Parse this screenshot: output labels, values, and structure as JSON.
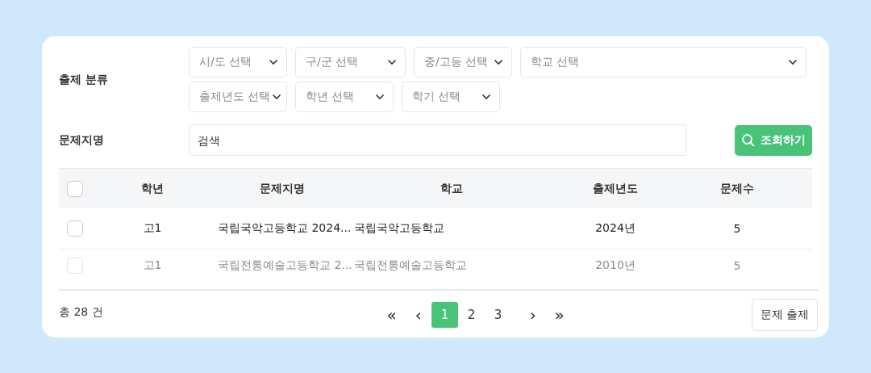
{
  "filters": {
    "label": "출제 분류",
    "selects": [
      [
        {
          "placeholder": "시/도 선택"
        },
        {
          "placeholder": "구/군 선택"
        },
        {
          "placeholder": "중/고등 선택"
        },
        {
          "placeholder": "학교 선택"
        }
      ],
      [
        {
          "placeholder": "출제년도 선택"
        },
        {
          "placeholder": "학년 선택"
        },
        {
          "placeholder": "학기 선택"
        }
      ]
    ]
  },
  "search": {
    "label": "문제지명",
    "placeholder": "검색",
    "button": "조회하기"
  },
  "table": {
    "columns": [
      "학년",
      "문제지명",
      "학교",
      "출제년도",
      "문제수"
    ],
    "header_checked": false,
    "rows": [
      {
        "checked": false,
        "faded": false,
        "cells": [
          "고1",
          "국립국악고등학교 2024...",
          "국립국악고등학교",
          "2024년",
          "5"
        ]
      },
      {
        "checked": false,
        "faded": true,
        "cells": [
          "고1",
          "국립전통예술고등학교 2...",
          "국립전통예술고등학교",
          "2010년",
          "5"
        ]
      }
    ]
  },
  "footer": {
    "total": "총 28 건",
    "first": "«",
    "prev": "‹",
    "pages": [
      {
        "label": "1",
        "selected": true
      },
      {
        "label": "2",
        "selected": false
      },
      {
        "label": "3",
        "selected": false
      }
    ],
    "next": "›",
    "last": "»",
    "action": "문제 출제"
  }
}
